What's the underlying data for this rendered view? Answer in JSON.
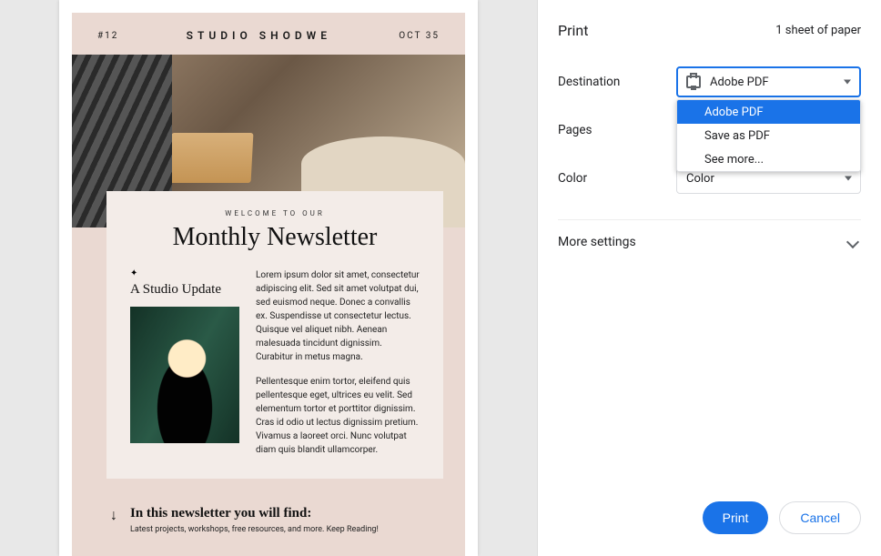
{
  "preview": {
    "issue": "#12",
    "brand": "STUDIO SHODWE",
    "date": "OCT 35",
    "kicker": "WELCOME TO OUR",
    "headline": "Monthly Newsletter",
    "subhead": "A Studio Update",
    "para1": "Lorem ipsum dolor sit amet, consectetur adipiscing elit. Sed sit amet volutpat dui, sed euismod neque. Donec a convallis ex. Suspendisse ut consectetur lectus. Quisque vel aliquet nibh. Aenean malesuada tincidunt dignissim. Curabitur in metus magna.",
    "para2": "Pellentesque enim tortor, eleifend quis pellentesque eget, ultrices eu velit. Sed elementum tortor et porttitor dignissim. Cras id odio ut lectus dignissim pretium. Vivamus a laoreet orci. Nunc volutpat diam quis blandit ullamcorper.",
    "footer_heading": "In this newsletter you will find:",
    "footer_sub": "Latest projects, workshops, free resources, and more. Keep Reading!"
  },
  "panel": {
    "title": "Print",
    "sheet_count": "1 sheet of paper",
    "labels": {
      "destination": "Destination",
      "pages": "Pages",
      "color": "Color",
      "more": "More settings"
    },
    "destination_value": "Adobe PDF",
    "destination_options": [
      "Adobe PDF",
      "Save as PDF",
      "See more..."
    ],
    "color_value": "Color",
    "buttons": {
      "print": "Print",
      "cancel": "Cancel"
    }
  }
}
